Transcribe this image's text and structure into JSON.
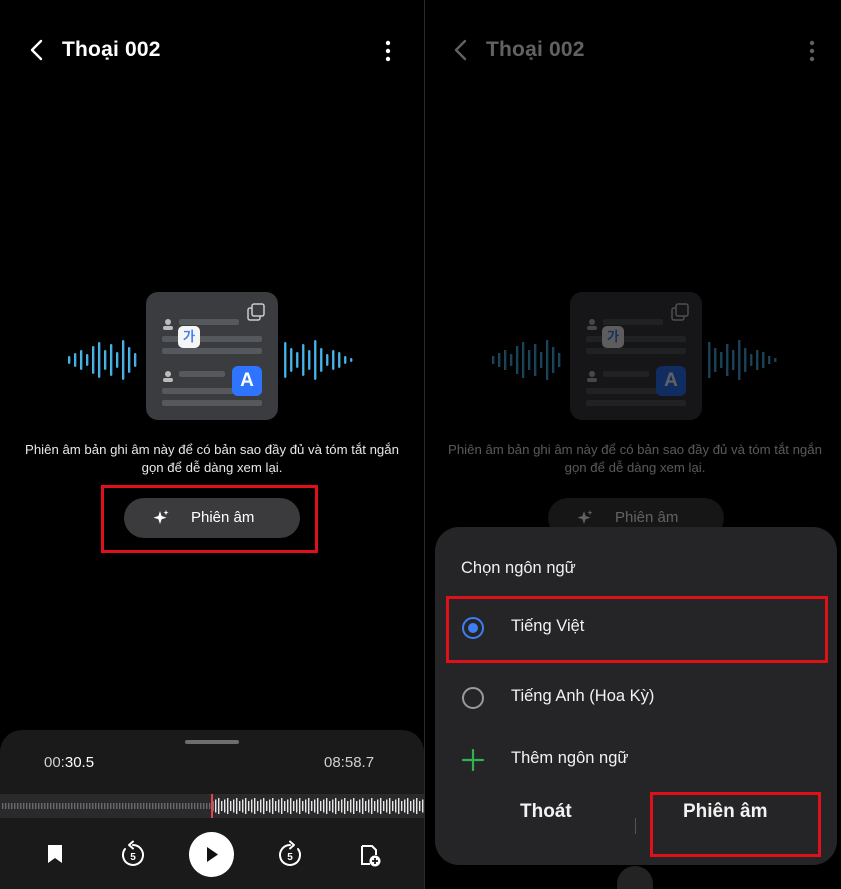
{
  "left": {
    "header": {
      "title": "Thoại 002"
    },
    "illustration": {
      "badge_korean": "가",
      "badge_letter": "A"
    },
    "caption": "Phiên âm bản ghi âm này để có bản sao đầy đủ và tóm tắt ngắn gọn để dễ dàng xem lại.",
    "transcribe_button": "Phiên âm",
    "player": {
      "elapsed_prefix": "00:",
      "elapsed_seconds": "30.5",
      "total": "08:58.7",
      "rewind_seconds": "5",
      "forward_seconds": "5"
    }
  },
  "right": {
    "header": {
      "title": "Thoại 002"
    },
    "illustration": {
      "badge_korean": "가",
      "badge_letter": "A"
    },
    "caption": "Phiên âm bản ghi âm này để có bản sao đầy đủ và tóm tắt ngắn gọn để dễ dàng xem lại.",
    "transcribe_button": "Phiên âm",
    "language_sheet": {
      "title": "Chọn ngôn ngữ",
      "options": [
        {
          "label": "Tiếng Việt",
          "selected": true
        },
        {
          "label": "Tiếng Anh (Hoa Kỳ)",
          "selected": false
        }
      ],
      "add_language": "Thêm ngôn ngữ",
      "cancel": "Thoát",
      "confirm": "Phiên âm"
    }
  },
  "colors": {
    "highlight": "#e0101a",
    "accent_blue": "#3f7ef0",
    "add_green": "#2fb24f",
    "wave_teal": "#3fd0c6",
    "wave_blue": "#4a8cff"
  },
  "icons": [
    "back-arrow-icon",
    "more-vertical-icon",
    "sparkle-icon",
    "bookmark-icon",
    "rewind-5-icon",
    "play-icon",
    "forward-5-icon",
    "add-note-icon",
    "plus-icon",
    "radio-selected-icon",
    "radio-unselected-icon"
  ]
}
